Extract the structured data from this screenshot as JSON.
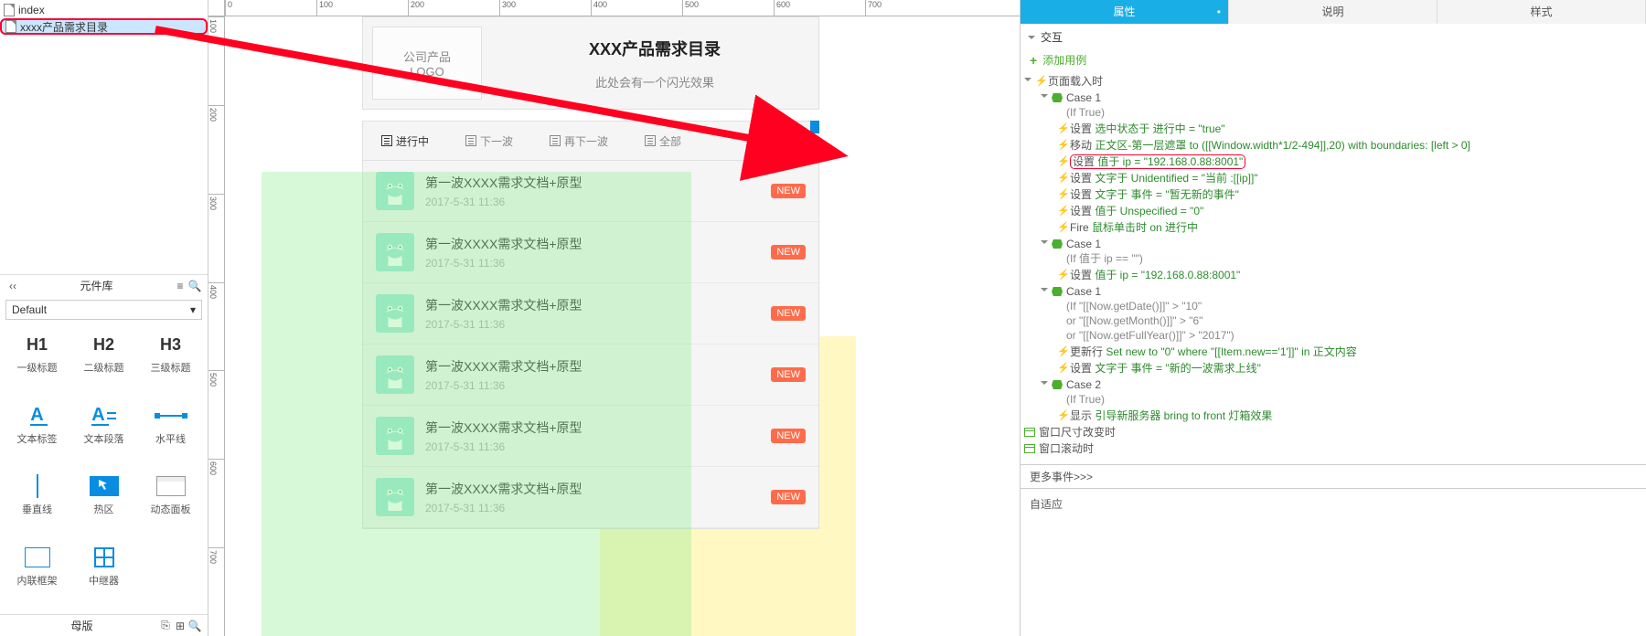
{
  "tree": {
    "index": "index",
    "selected": "xxxx产品需求目录"
  },
  "lib": {
    "title": "元件库",
    "default": "Default",
    "items": [
      {
        "big": "H1",
        "lab": "一级标题"
      },
      {
        "big": "H2",
        "lab": "二级标题"
      },
      {
        "big": "H3",
        "lab": "三级标题"
      },
      {
        "type": "a",
        "lab": "文本标签"
      },
      {
        "type": "ap",
        "lab": "文本段落"
      },
      {
        "type": "line",
        "lab": "水平线"
      },
      {
        "type": "vline",
        "lab": "垂直线"
      },
      {
        "type": "hot",
        "lab": "热区"
      },
      {
        "type": "dyn",
        "lab": "动态面板"
      },
      {
        "type": "if",
        "lab": "内联框架"
      },
      {
        "type": "rep",
        "lab": "中继器"
      }
    ],
    "footer": "母版"
  },
  "ruler_h": [
    "0",
    "100",
    "200",
    "300",
    "400",
    "500",
    "600",
    "700"
  ],
  "ruler_v": [
    "100",
    "200",
    "300",
    "400",
    "500",
    "600",
    "700"
  ],
  "mock": {
    "logo_l1": "公司产品",
    "logo_l2": "LOGO",
    "title": "XXX产品需求目录",
    "sub": "此处会有一个闪光效果",
    "tabs": [
      "进行中",
      "下一波",
      "再下一波",
      "全部"
    ],
    "item_title": "第一波XXXX需求文档+原型",
    "item_time": "2017-5-31 11:36",
    "badge": "NEW"
  },
  "rp": {
    "tabs": [
      "属性",
      "说明",
      "样式"
    ],
    "interaction": "交互",
    "add": "添加用例",
    "more": "更多事件>>>",
    "fit": "自适应",
    "events": {
      "load": "页面载入时",
      "resize": "窗口尺寸改变时",
      "scroll": "窗口滚动时"
    },
    "case1": "Case 1",
    "case2": "Case 2",
    "iftrue": "(If True)",
    "ifip": "(If 值于 ip == \"\")",
    "ifdate_l1": "(If \"[[Now.getDate()]]\" > \"10\"",
    "ifdate_l2": "or \"[[Now.getMonth()]]\" > \"6\"",
    "ifdate_l3": "or \"[[Now.getFullYear()]]\" > \"2017\")",
    "a_set": "设置",
    "a_move": "移动",
    "a_fire": "Fire",
    "a_update": "更新行",
    "a_show": "显示",
    "v1": "选中状态于 进行中 = \"true\"",
    "v2": "正文区-第一层遮罩 to ([[Window.width*1/2-494]],20) with boundaries: [left > 0]",
    "v3": "值于 ip = \"192.168.0.88:8001\"",
    "v4": "文字于 Unidentified = \"当前 :[[ip]]\"",
    "v5": "文字于 事件 = \"暂无新的事件\"",
    "v6": "值于 Unspecified = \"0\"",
    "v7": "鼠标单击时 on 进行中",
    "v8": "值于 ip = \"192.168.0.88:8001\"",
    "v9": "Set new to \"0\" where \"[[Item.new=='1']]\" in 正文内容",
    "v10": "文字于 事件 = \"新的一波需求上线\"",
    "v11": "引导新服务器 bring to front 灯箱效果"
  }
}
